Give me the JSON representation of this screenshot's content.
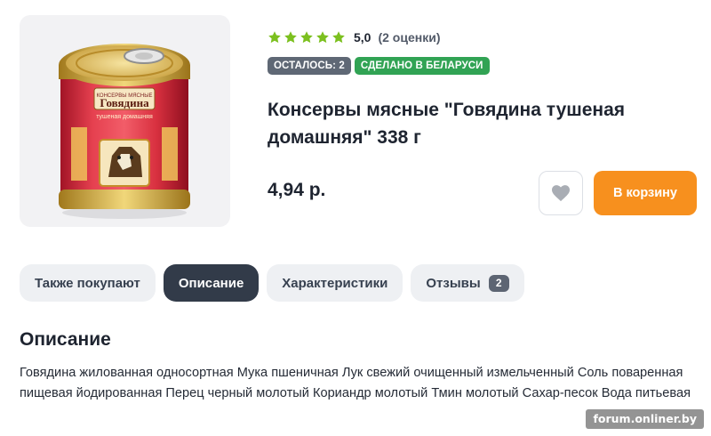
{
  "product": {
    "image_alt": "canned beef tin",
    "image_label_line1": "КОНСЕРВЫ МЯСНЫЕ",
    "image_label_main": "Говядина",
    "image_label_line3": "тушеная домашняя",
    "rating": {
      "stars": 5,
      "value": "5,0",
      "count_text": "(2 оценки)",
      "star_color": "#7cc01f"
    },
    "badges": {
      "stock": "ОСТАЛОСЬ: 2",
      "made_in": "СДЕЛАНО В БЕЛАРУСИ"
    },
    "title": "Консервы мясные \"Говядина тушеная домашняя\" 338 г",
    "price": "4,94 р.",
    "favorite_icon": "heart-icon",
    "cart_label": "В корзину",
    "accent_color": "#f7901e"
  },
  "tabs": [
    {
      "label": "Также покупают",
      "active": false
    },
    {
      "label": "Описание",
      "active": true
    },
    {
      "label": "Характеристики",
      "active": false
    },
    {
      "label": "Отзывы",
      "active": false,
      "count": "2"
    }
  ],
  "description": {
    "heading": "Описание",
    "text": "Говядина жилованная односортная Мука пшеничная Лук свежий очищенный измельченный Соль поваренная пищевая йодированная Перец черный молотый Кориандр молотый Тмин молотый Сахар-песок Вода питьевая"
  },
  "watermark": "forum.onliner.by"
}
